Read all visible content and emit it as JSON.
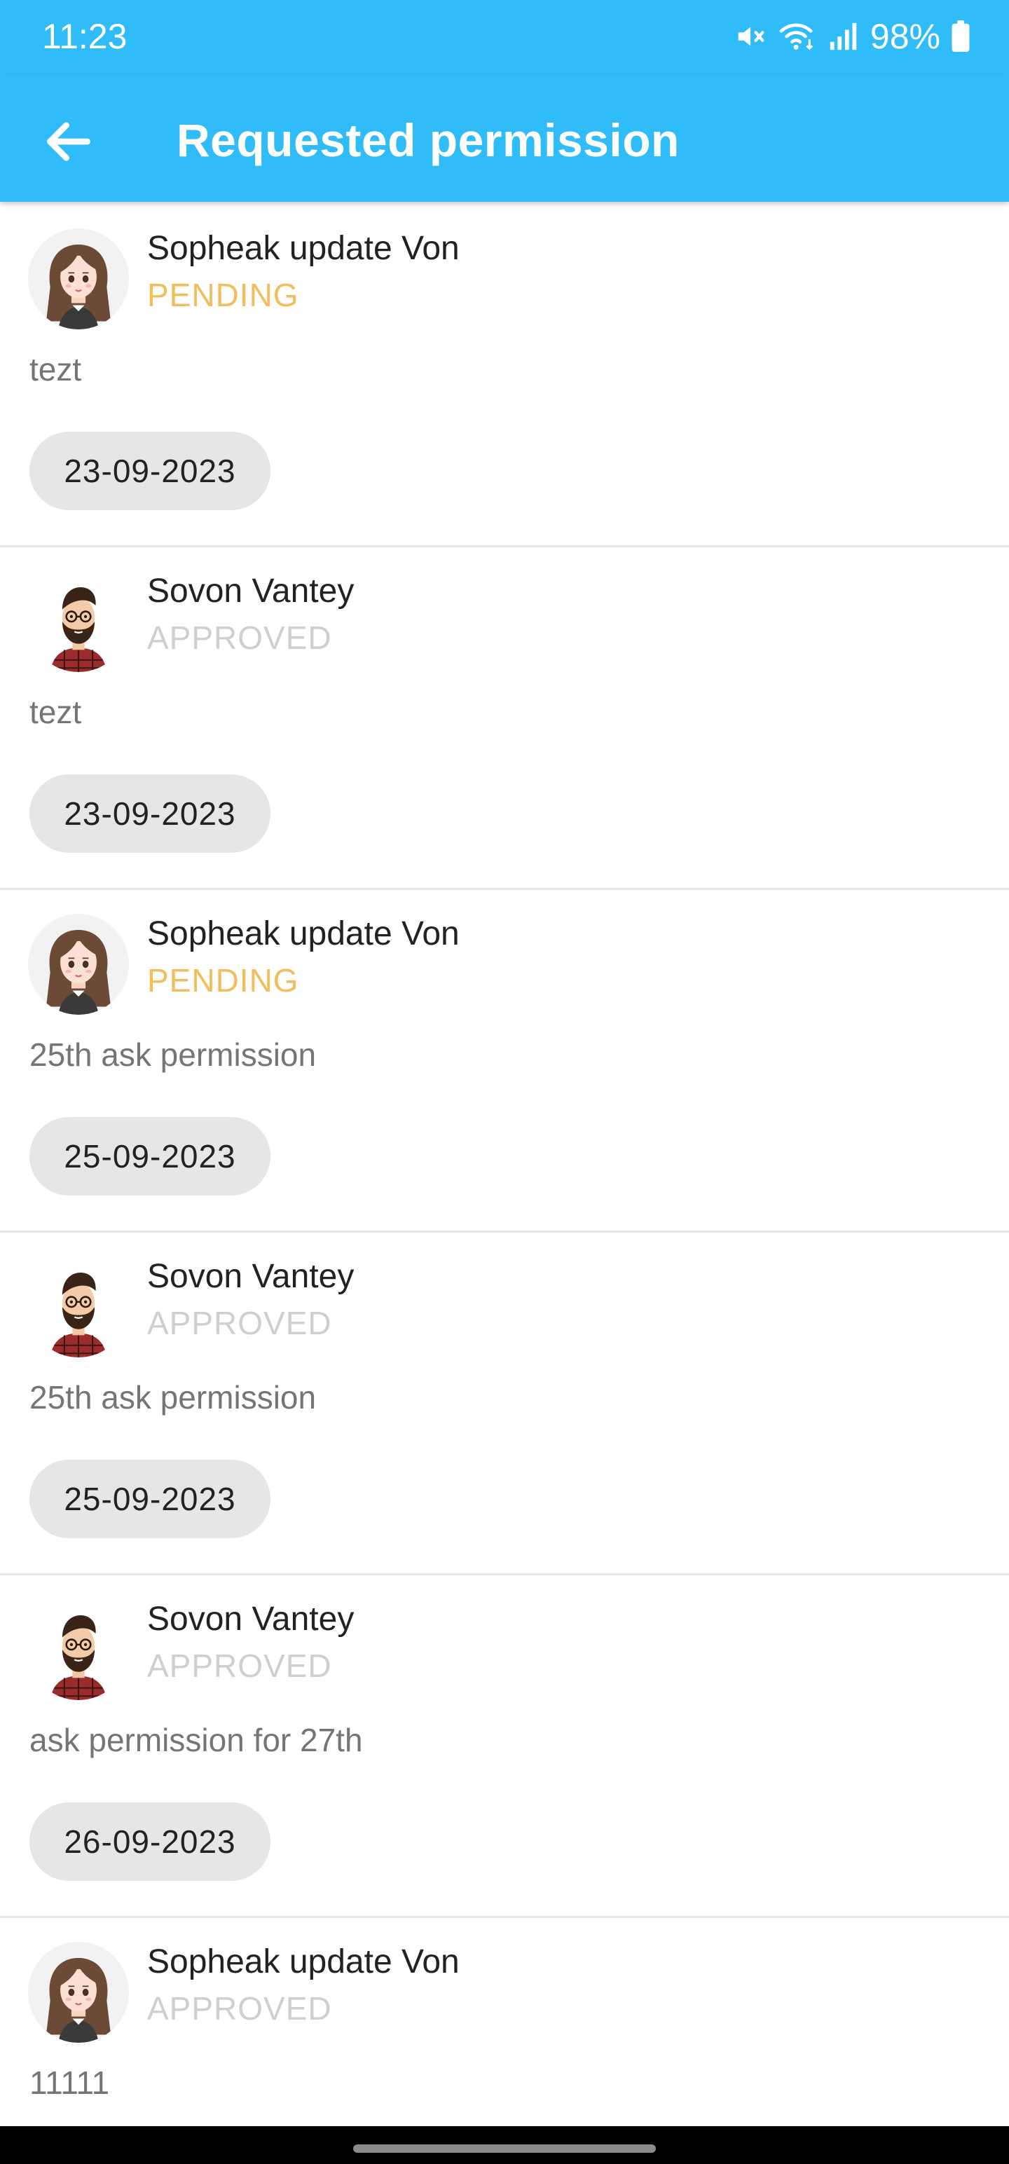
{
  "status_bar": {
    "time": "11:23",
    "battery": "98%",
    "icons": [
      "mute-icon",
      "wifi-icon",
      "signal-icon",
      "battery-icon"
    ]
  },
  "app_bar": {
    "title": "Requested permission",
    "back_icon": "arrow-left-icon",
    "color": "#30bcf8"
  },
  "colors": {
    "pending": "#f2be5c",
    "approved": "#cfcfcf",
    "chip": "#e6e6e6"
  },
  "requests": [
    {
      "name": "Sopheak update Von",
      "status": "PENDING",
      "status_type": "pending",
      "message": "tezt",
      "date": "23-09-2023",
      "avatar": "female-avatar"
    },
    {
      "name": "Sovon Vantey",
      "status": "APPROVED",
      "status_type": "approved",
      "message": "tezt",
      "date": "23-09-2023",
      "avatar": "male-avatar"
    },
    {
      "name": "Sopheak update Von",
      "status": "PENDING",
      "status_type": "pending",
      "message": "25th ask permission",
      "date": "25-09-2023",
      "avatar": "female-avatar"
    },
    {
      "name": "Sovon Vantey",
      "status": "APPROVED",
      "status_type": "approved",
      "message": "25th ask permission",
      "date": "25-09-2023",
      "avatar": "male-avatar"
    },
    {
      "name": "Sovon Vantey",
      "status": "APPROVED",
      "status_type": "approved",
      "message": "ask permission for 27th",
      "date": "26-09-2023",
      "avatar": "male-avatar"
    },
    {
      "name": "Sopheak update Von",
      "status": "APPROVED",
      "status_type": "approved",
      "message": "11111",
      "date": "",
      "avatar": "female-avatar"
    }
  ]
}
